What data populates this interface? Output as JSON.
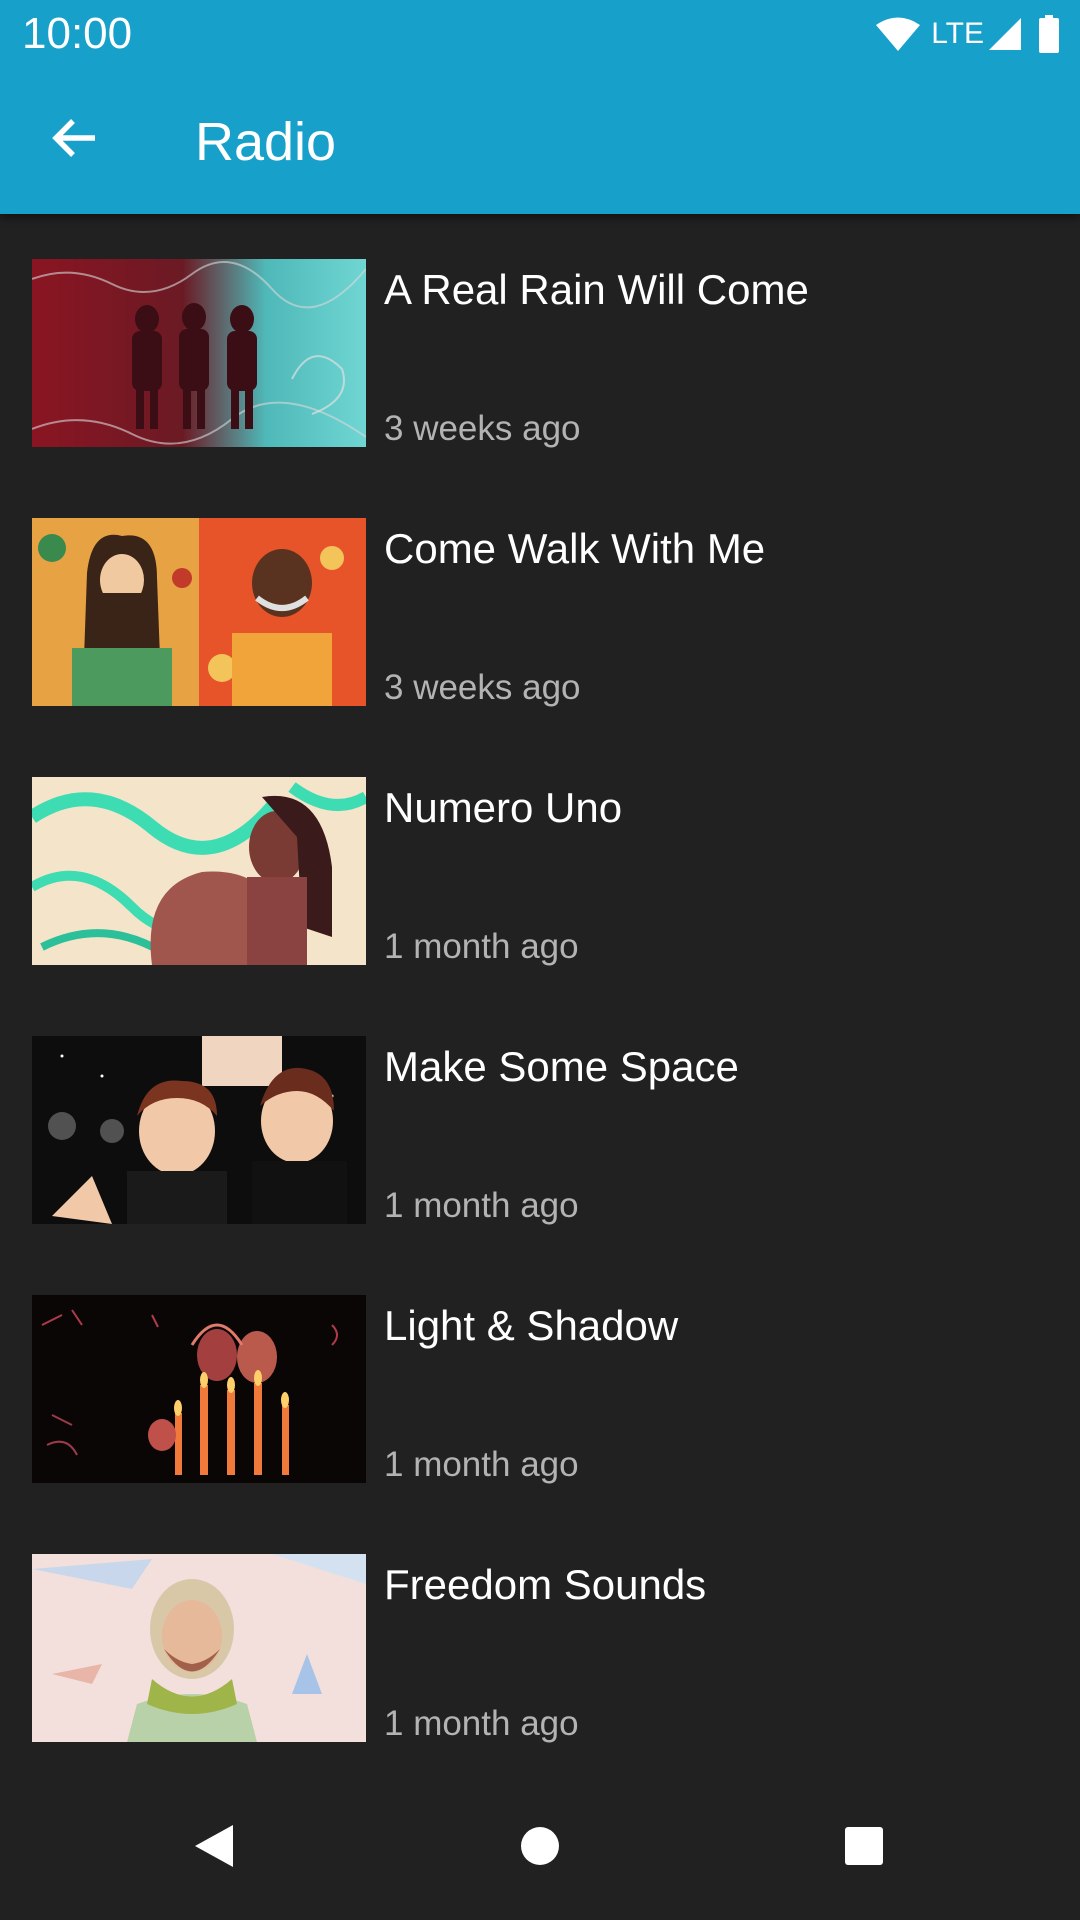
{
  "status_bar": {
    "time": "10:00",
    "network": "LTE",
    "icons": [
      "wifi-icon",
      "cell-signal-icon",
      "battery-icon"
    ]
  },
  "app_bar": {
    "title": "Radio",
    "back_icon": "arrow-back-icon"
  },
  "colors": {
    "app_bar": "#17a0c9",
    "background": "#212121",
    "title_text": "#ffffff",
    "date_text": "#b3b3b3"
  },
  "episodes": [
    {
      "title": "A Real Rain Will Come",
      "date": "3 weeks ago"
    },
    {
      "title": "Come Walk With Me",
      "date": "3 weeks ago"
    },
    {
      "title": "Numero Uno",
      "date": "1 month ago"
    },
    {
      "title": "Make Some Space",
      "date": "1 month ago"
    },
    {
      "title": "Light & Shadow",
      "date": "1 month ago"
    },
    {
      "title": "Freedom Sounds",
      "date": "1 month ago"
    }
  ],
  "nav_bar": {
    "icons": [
      "back-triangle-icon",
      "home-circle-icon",
      "recents-square-icon"
    ]
  }
}
